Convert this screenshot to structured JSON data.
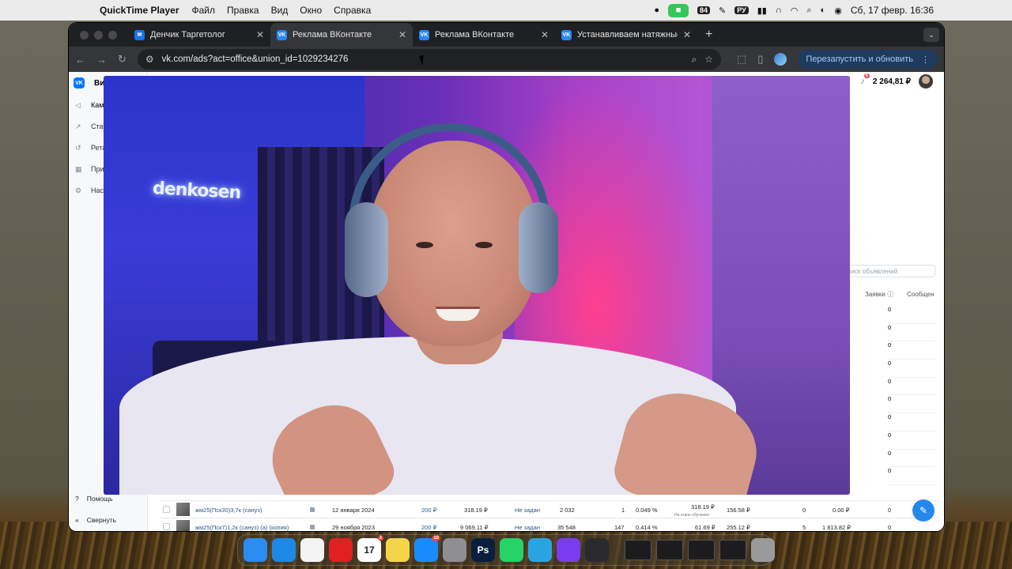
{
  "menubar": {
    "app_name": "QuickTime Player",
    "menus": [
      "Файл",
      "Правка",
      "Вид",
      "Окно",
      "Справка"
    ],
    "status": {
      "notifications_count": "84",
      "input_lang": "РУ",
      "datetime": "Сб, 17 февр.  16:36"
    }
  },
  "browser": {
    "tabs": [
      {
        "label": "Денчик Таргетолог",
        "icon": "messages-icon"
      },
      {
        "label": "Реклама ВКонтакте",
        "icon": "vk-icon",
        "active": true
      },
      {
        "label": "Реклама ВКонтакте",
        "icon": "vk-icon"
      },
      {
        "label": "Устанавливаем натяжные по",
        "icon": "vk-icon"
      }
    ],
    "url": "vk.com/ads?act=office&union_id=1029234276",
    "relaunch_label": "Перезапустить и обновить"
  },
  "vk": {
    "brand": "Ви",
    "balance": "2 264,81 ₽",
    "notif_count": "6",
    "sidebar": [
      "Камп",
      "Стат",
      "Ретар",
      "Прил",
      "Наст"
    ],
    "sidebar_bottom": {
      "help": "Помощь",
      "collapse": "Свернуть"
    },
    "search_placeholder": "оиск объявлений",
    "columns": {
      "leads": "Заявки",
      "messages": "Сообщен"
    },
    "leads_values": [
      "0",
      "0",
      "0",
      "0",
      "0",
      "0",
      "0",
      "0",
      "0",
      "0"
    ],
    "rows": [
      {
        "name": "жм25(Пск30)3,7к (сануз)",
        "date": "12 января 2024",
        "budget": "200 ₽",
        "spent": "318.19 ₽",
        "limit": "Не задан",
        "impressions": "2 032",
        "clicks": "1",
        "ctr": "0.049 %",
        "cpc": "318.19 ₽",
        "cpc_note": "На этапе обучения",
        "cpm": "156.58 ₽",
        "conv": "0",
        "cost": "0.00 ₽",
        "leads": "0"
      },
      {
        "name": "жм25(Пск7)1,2к (сануз) (а) (копия)",
        "date": "29 ноября 2023",
        "budget": "200 ₽",
        "spent": "9 069.11 ₽",
        "limit": "Не задан",
        "impressions": "35 548",
        "clicks": "147",
        "ctr": "0.414 %",
        "cpc": "61.69 ₽",
        "cpc_note": "",
        "cpm": "255.12 ₽",
        "conv": "5",
        "cost": "1 813.82 ₽",
        "leads": "0"
      }
    ]
  },
  "video": {
    "neon_sign": "denkosen"
  },
  "dock": {
    "apps": [
      {
        "name": "finder-icon",
        "color": "#2a8cf0"
      },
      {
        "name": "safari-icon",
        "color": "#1e88e5"
      },
      {
        "name": "chrome-icon",
        "color": "#f4f4f4"
      },
      {
        "name": "opera-icon",
        "color": "#e0201f"
      },
      {
        "name": "calendar-icon",
        "color": "#ffffff",
        "label": "17",
        "badge": "3"
      },
      {
        "name": "notes-icon",
        "color": "#f6d44a"
      },
      {
        "name": "app-store-icon",
        "color": "#1a8cff",
        "badge": "10"
      },
      {
        "name": "system-settings-icon",
        "color": "#8e8e93"
      },
      {
        "name": "photoshop-icon",
        "color": "#0a1f3d",
        "label": "Ps"
      },
      {
        "name": "whatsapp-icon",
        "color": "#25d366"
      },
      {
        "name": "telegram-icon",
        "color": "#2aa4e0"
      },
      {
        "name": "yandex-messenger-icon",
        "color": "#7a3cf0"
      },
      {
        "name": "quicktime-icon",
        "color": "#2a2a2e"
      }
    ]
  }
}
